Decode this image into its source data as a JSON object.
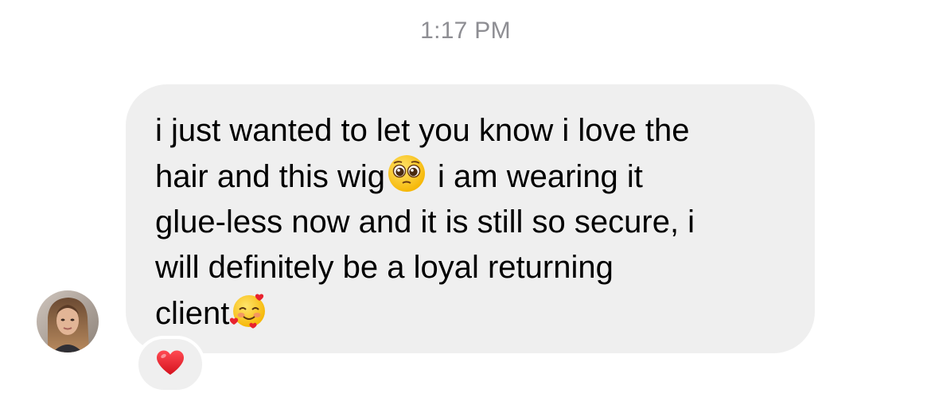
{
  "timestamp": "1:17 PM",
  "message": {
    "line1": "i just wanted to let you know i love the",
    "line2_before": "hair and this wig",
    "line2_emoji": "pleading-face-icon",
    "line2_after": "i am wearing it",
    "line3": "glue-less now and it is still so secure, i",
    "line4": "will definitely be a loyal returning",
    "line5": "client",
    "line5_emoji": "smiling-face-with-hearts-icon"
  },
  "reaction": "heart-icon",
  "colors": {
    "bubble": "#efefef",
    "timestamp": "#8e8e93",
    "heart": "#e8232f"
  }
}
